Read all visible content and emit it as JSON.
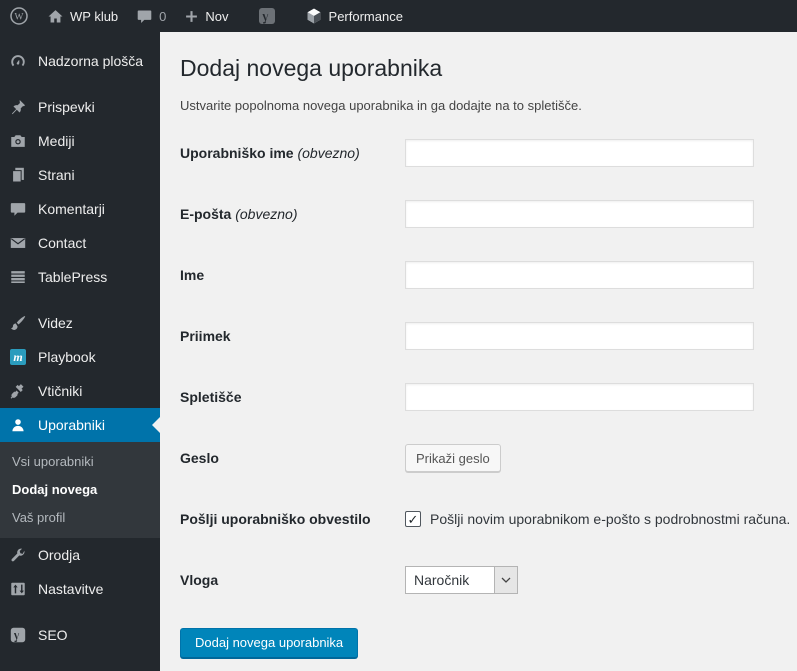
{
  "admin_bar": {
    "site_name": "WP klub",
    "comment_count": "0",
    "new_label": "Nov",
    "performance_label": "Performance"
  },
  "sidebar": {
    "items": [
      {
        "label": "Nadzorna plošča",
        "icon": "dashboard-icon"
      },
      {
        "label": "Prispevki",
        "icon": "pin-icon"
      },
      {
        "label": "Mediji",
        "icon": "camera-icon"
      },
      {
        "label": "Strani",
        "icon": "pages-icon"
      },
      {
        "label": "Komentarji",
        "icon": "comment-icon"
      },
      {
        "label": "Contact",
        "icon": "envelope-icon"
      },
      {
        "label": "TablePress",
        "icon": "table-icon"
      },
      {
        "label": "Videz",
        "icon": "brush-icon"
      },
      {
        "label": "Playbook",
        "icon": "playbook-m-icon"
      },
      {
        "label": "Vtičniki",
        "icon": "plug-icon"
      },
      {
        "label": "Uporabniki",
        "icon": "user-icon"
      },
      {
        "label": "Orodja",
        "icon": "wrench-icon"
      },
      {
        "label": "Nastavitve",
        "icon": "sliders-icon"
      },
      {
        "label": "SEO",
        "icon": "yoast-icon"
      }
    ],
    "submenu": [
      {
        "label": "Vsi uporabniki"
      },
      {
        "label": "Dodaj novega"
      },
      {
        "label": "Vaš profil"
      }
    ]
  },
  "main": {
    "title": "Dodaj novega uporabnika",
    "subtitle": "Ustvarite popolnoma novega uporabnika in ga dodajte na to spletišče.",
    "fields": [
      {
        "label": "Uporabniško ime",
        "required": "(obvezno)"
      },
      {
        "label": "E-pošta",
        "required": "(obvezno)"
      },
      {
        "label": "Ime",
        "required": ""
      },
      {
        "label": "Priimek",
        "required": ""
      },
      {
        "label": "Spletišče",
        "required": ""
      }
    ],
    "password_label": "Geslo",
    "password_button": "Prikaži geslo",
    "notification_label": "Pošlji uporabniško obvestilo",
    "notification_checkbox_checked": "✓",
    "notification_text": "Pošlji novim uporabnikom e-pošto s podrobnostmi računa.",
    "role_label": "Vloga",
    "role_value": "Naročnik",
    "submit_label": "Dodaj novega uporabnika"
  },
  "colors": {
    "adminbar_bg": "#23282d",
    "sidebar_bg": "#23282d",
    "submenu_bg": "#32373c",
    "active_menu_bg": "#0073aa",
    "content_bg": "#f1f1f1",
    "primary_button_bg": "#0085ba",
    "playbook_badge_bg": "#2b9cbd"
  }
}
